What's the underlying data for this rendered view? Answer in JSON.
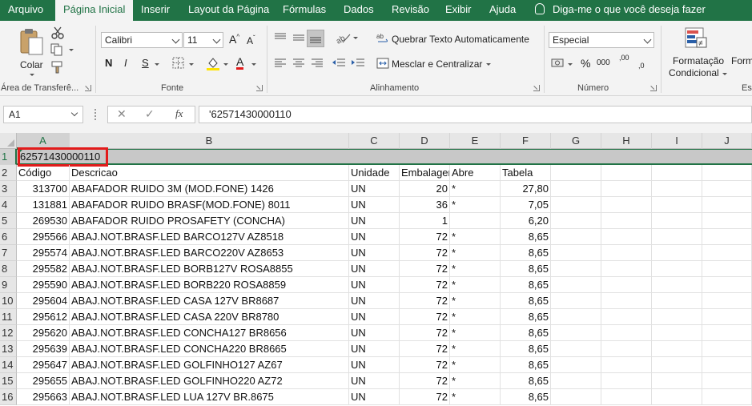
{
  "tabs": [
    "Arquivo",
    "Página Inicial",
    "Inserir",
    "Layout da Página",
    "Fórmulas",
    "Dados",
    "Revisão",
    "Exibir",
    "Ajuda"
  ],
  "tell_me": "Diga-me o que você deseja fazer",
  "ribbon": {
    "clipboard": {
      "paste_label": "Colar",
      "group_label": "Área de Transferê..."
    },
    "font": {
      "name": "Calibri",
      "size": "11",
      "bold": "N",
      "italic": "I",
      "underline": "S",
      "group_label": "Fonte"
    },
    "alignment": {
      "wrap_text": "Quebrar Texto Automaticamente",
      "merge_center": "Mesclar e Centralizar",
      "group_label": "Alinhamento"
    },
    "number": {
      "format": "Especial",
      "percent": "%",
      "thousands": "000",
      "dec_inc": ",00",
      "dec_dec": ",0",
      "group_label": "Número"
    },
    "styles": {
      "cond_format_1": "Formatação",
      "cond_format_2": "Condicional",
      "next_1": "Forma",
      "next_2": "Es"
    }
  },
  "formula_bar": {
    "name_box": "A1",
    "fx": "fx",
    "content": "'62571430000110"
  },
  "columns": [
    "A",
    "B",
    "C",
    "D",
    "E",
    "F",
    "G",
    "H",
    "I",
    "J"
  ],
  "rows": [
    {
      "n": "1",
      "A": "62571430000110",
      "B": "",
      "C": "",
      "D": "",
      "E": "",
      "F": ""
    },
    {
      "n": "2",
      "A": "Código",
      "B": "Descricao",
      "C": "Unidade",
      "D": "Embalagem",
      "E": "Abre",
      "F": "Tabela"
    },
    {
      "n": "3",
      "A": "313700",
      "B": "ABAFADOR RUIDO 3M (MOD.FONE)   1426",
      "C": "UN",
      "D": "20",
      "E": "*",
      "F": "27,80"
    },
    {
      "n": "4",
      "A": "131881",
      "B": "ABAFADOR RUIDO BRASF(MOD.FONE) 8011",
      "C": "UN",
      "D": "36",
      "E": "*",
      "F": "7,05"
    },
    {
      "n": "5",
      "A": "269530",
      "B": "ABAFADOR RUIDO PROSAFETY (CONCHA)",
      "C": "UN",
      "D": "1",
      "E": "",
      "F": "6,20"
    },
    {
      "n": "6",
      "A": "295566",
      "B": "ABAJ.NOT.BRASF.LED BARCO127V AZ8518",
      "C": "UN",
      "D": "72",
      "E": "*",
      "F": "8,65"
    },
    {
      "n": "7",
      "A": "295574",
      "B": "ABAJ.NOT.BRASF.LED BARCO220V AZ8653",
      "C": "UN",
      "D": "72",
      "E": "*",
      "F": "8,65"
    },
    {
      "n": "8",
      "A": "295582",
      "B": "ABAJ.NOT.BRASF.LED BORB127V ROSA8855",
      "C": "UN",
      "D": "72",
      "E": "*",
      "F": "8,65"
    },
    {
      "n": "9",
      "A": "295590",
      "B": "ABAJ.NOT.BRASF.LED BORB220 ROSA8859",
      "C": "UN",
      "D": "72",
      "E": "*",
      "F": "8,65"
    },
    {
      "n": "10",
      "A": "295604",
      "B": "ABAJ.NOT.BRASF.LED CASA 127V BR8687",
      "C": "UN",
      "D": "72",
      "E": "*",
      "F": "8,65"
    },
    {
      "n": "11",
      "A": "295612",
      "B": "ABAJ.NOT.BRASF.LED CASA 220V BR8780",
      "C": "UN",
      "D": "72",
      "E": "*",
      "F": "8,65"
    },
    {
      "n": "12",
      "A": "295620",
      "B": "ABAJ.NOT.BRASF.LED CONCHA127 BR8656",
      "C": "UN",
      "D": "72",
      "E": "*",
      "F": "8,65"
    },
    {
      "n": "13",
      "A": "295639",
      "B": "ABAJ.NOT.BRASF.LED CONCHA220 BR8665",
      "C": "UN",
      "D": "72",
      "E": "*",
      "F": "8,65"
    },
    {
      "n": "14",
      "A": "295647",
      "B": "ABAJ.NOT.BRASF.LED GOLFINHO127 AZ67",
      "C": "UN",
      "D": "72",
      "E": "*",
      "F": "8,65"
    },
    {
      "n": "15",
      "A": "295655",
      "B": "ABAJ.NOT.BRASF.LED GOLFINHO220 AZ72",
      "C": "UN",
      "D": "72",
      "E": "*",
      "F": "8,65"
    },
    {
      "n": "16",
      "A": "295663",
      "B": "ABAJ.NOT.BRASF.LED LUA 127V BR.8675",
      "C": "UN",
      "D": "72",
      "E": "*",
      "F": "8,65"
    }
  ],
  "colors": {
    "accent": "#217346",
    "highlight_box": "#e21b1b"
  }
}
